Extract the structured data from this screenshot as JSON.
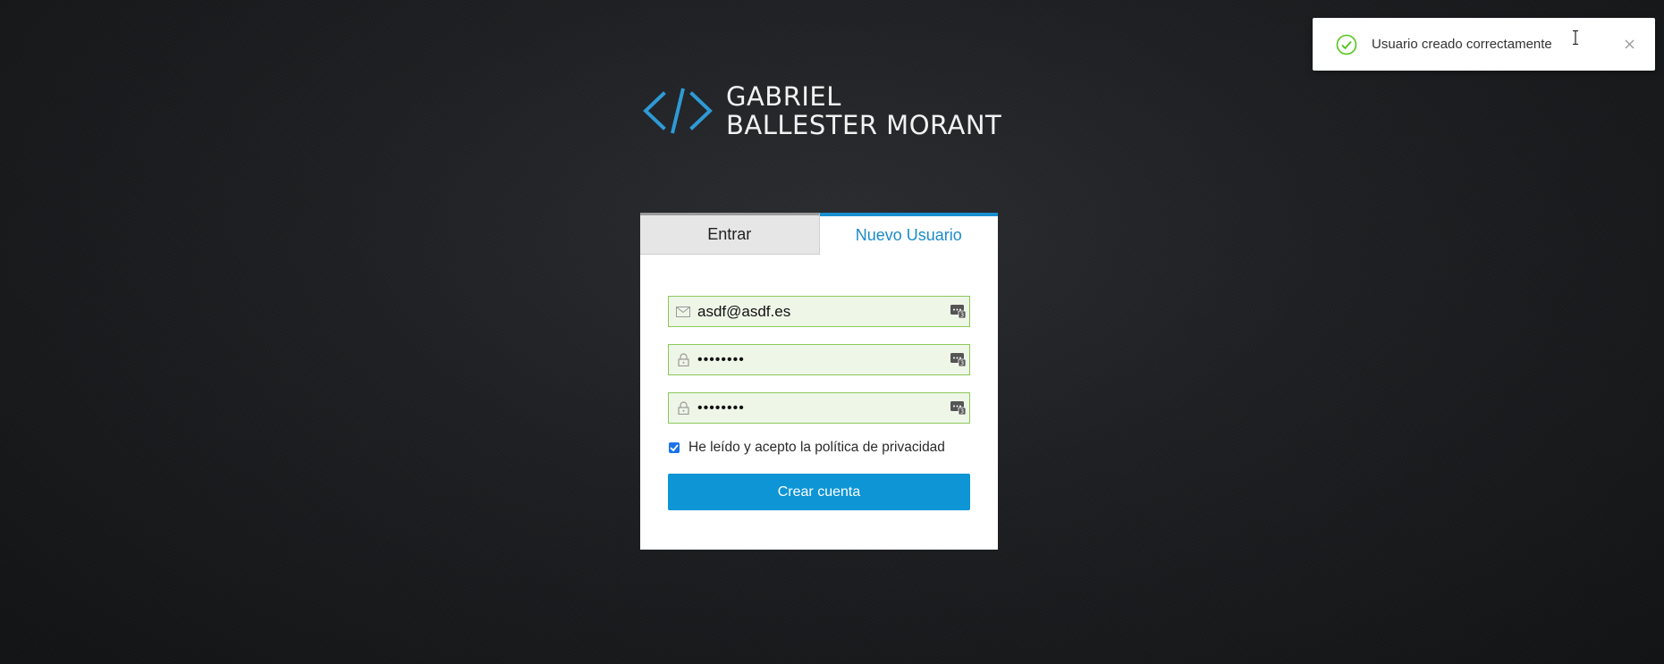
{
  "logo": {
    "line1": "GABRIEL",
    "line2": "BALLESTER MORANT",
    "mark_color": "#2e9ad6"
  },
  "tabs": [
    {
      "label": "Entrar",
      "active": false
    },
    {
      "label": "Nuevo Usuario",
      "active": true
    }
  ],
  "form": {
    "email_value": "asdf@asdf.es",
    "password_value": "••••••••",
    "password_confirm_value": "••••••••",
    "privacy_label": "He leído y acepto la política de privacidad",
    "privacy_checked": true,
    "submit_label": "Crear cuenta"
  },
  "toast": {
    "message": "Usuario creado correctamente",
    "status": "success",
    "status_color": "#52c41a"
  },
  "colors": {
    "accent": "#0d95d6",
    "field_border": "#8cc85a",
    "field_bg": "#eef6e8"
  }
}
